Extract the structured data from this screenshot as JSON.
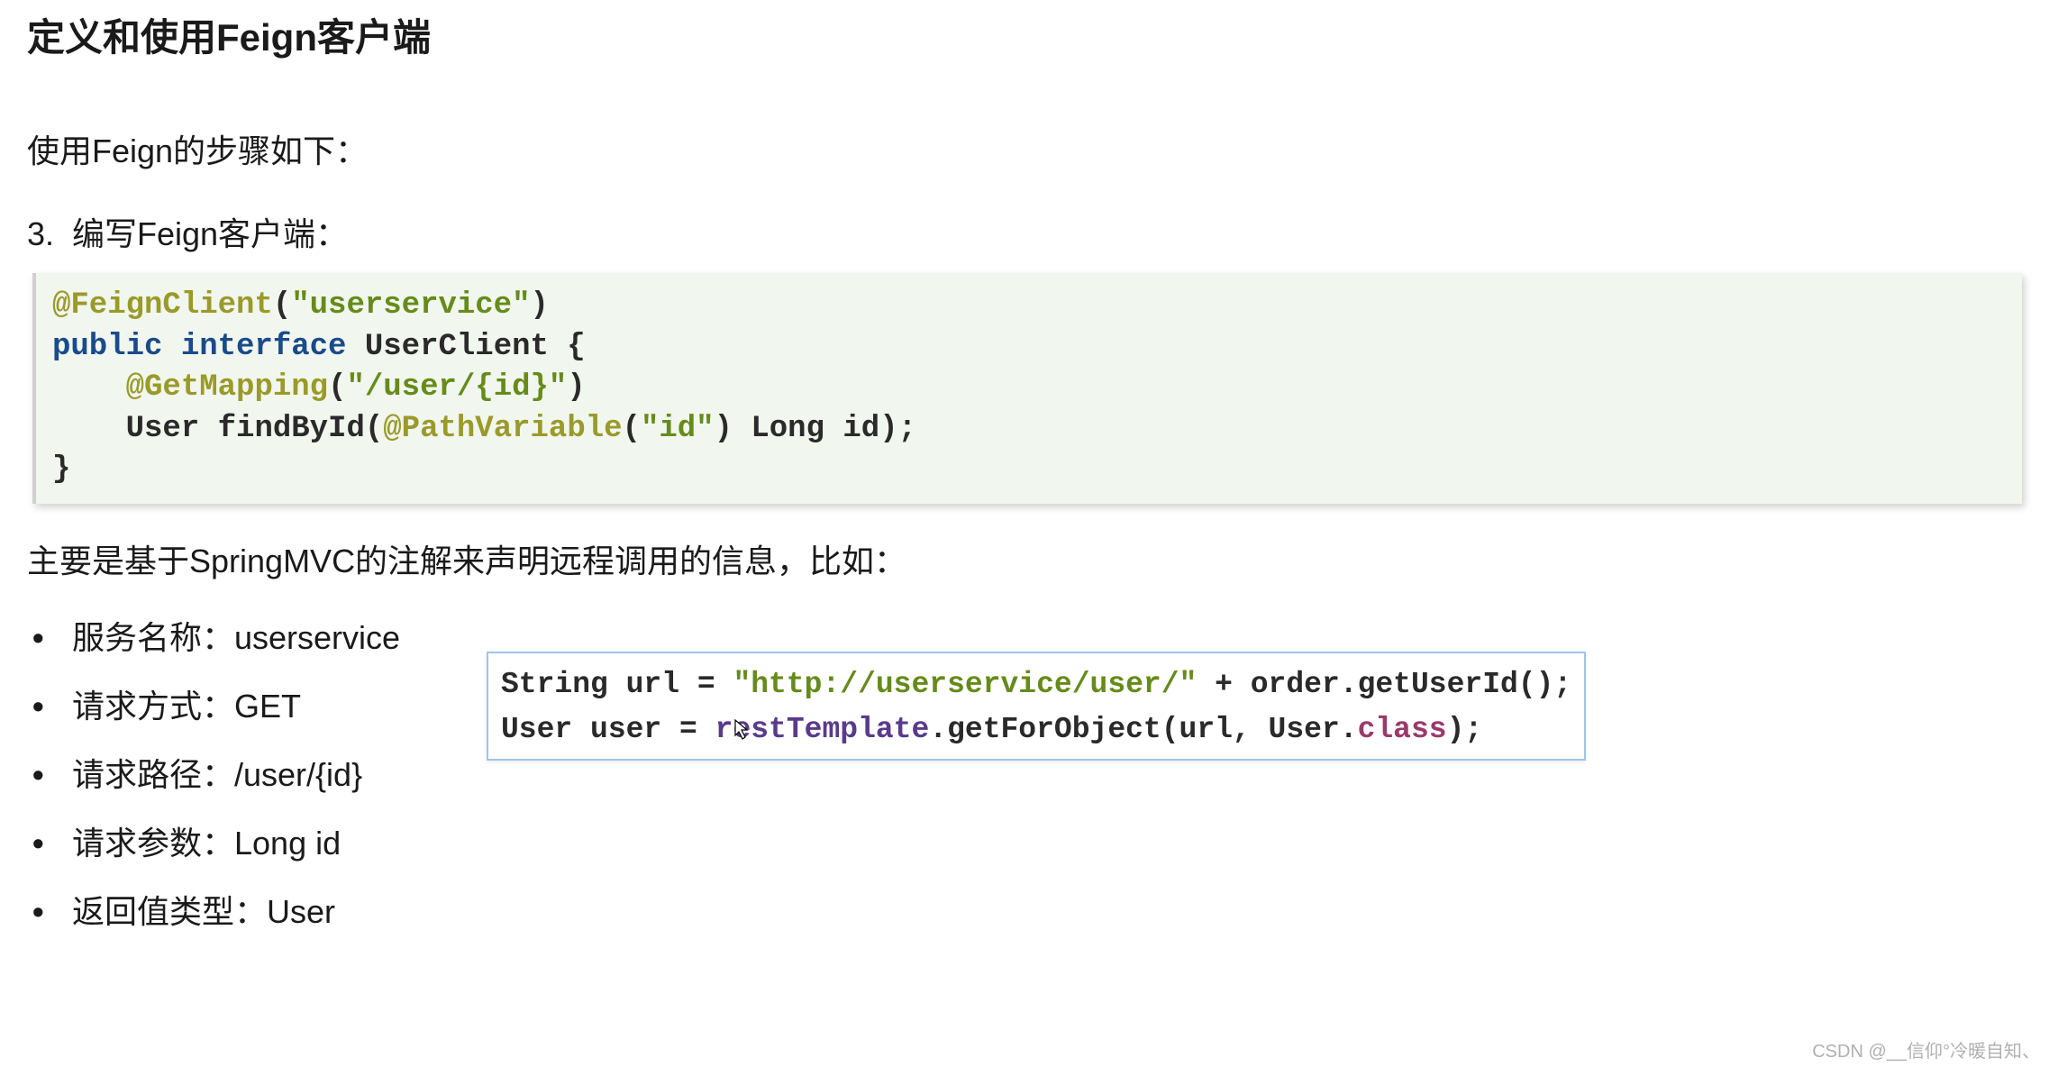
{
  "heading": "定义和使用Feign客户端",
  "subheading": "使用Feign的步骤如下：",
  "step": {
    "num": "3.",
    "text": "编写Feign客户端："
  },
  "code": {
    "line1_anno": "@FeignClient",
    "line1_paren_open": "(",
    "line1_str": "\"userservice\"",
    "line1_paren_close": ")",
    "line2_kw1": "public",
    "line2_kw2": "interface",
    "line2_name": " UserClient {",
    "line3_pad": "    ",
    "line3_anno": "@GetMapping",
    "line3_paren_open": "(",
    "line3_str": "\"/user/{id}\"",
    "line3_paren_close": ")",
    "line4_pad": "    ",
    "line4_ret": "User findById(",
    "line4_anno": "@PathVariable",
    "line4_paren_open": "(",
    "line4_str": "\"id\"",
    "line4_rest": ") Long id);",
    "line5": "}"
  },
  "description": "主要是基于SpringMVC的注解来声明远程调用的信息，比如：",
  "bullets": [
    "服务名称：userservice",
    "请求方式：GET",
    "请求路径：/user/{id}",
    "请求参数：Long id",
    "返回值类型：User"
  ],
  "floating": {
    "line1_a": "String url = ",
    "line1_url": "\"http://userservice/user/\"",
    "line1_b": " + order.getUserId();",
    "line2_a": "User user = ",
    "line2_var": "restTemplate",
    "line2_b": ".getForObject(url, User.",
    "line2_cls": "class",
    "line2_c": ");"
  },
  "watermark": "CSDN @__信仰°冷暖自知、"
}
